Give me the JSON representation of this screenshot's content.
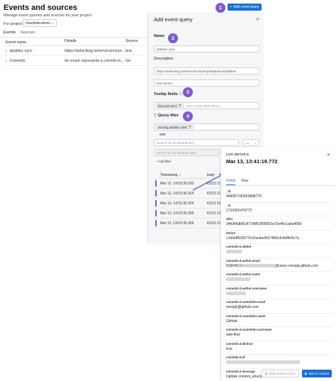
{
  "page": {
    "title": "Events and sources",
    "subtitle": "Manage event queries and sources for your project",
    "project_label": "For project",
    "project_value": "cloudsika-demo",
    "add_event_button": "Add event query",
    "tabs": [
      {
        "label": "Events"
      },
      {
        "label": "Sources"
      }
    ],
    "columns": [
      "Event name",
      "Details",
      "Source"
    ],
    "rows": [
      {
        "name": "iptables sync",
        "details": "https://www.tkng.io/services/clusterip/dataplane/iptables/",
        "source": "test"
      },
      {
        "name": "Commits",
        "details": "An event represents a commit to a repository",
        "source": "Git"
      }
    ]
  },
  "badges": [
    "1",
    "2",
    "3",
    "4"
  ],
  "query_panel": {
    "title": "Add event query",
    "name_label": "Name",
    "name_value": "iptables sync",
    "description_label": "Description",
    "description_value": "https://www.tkng.io/services/clusterip/dataplane/iptables/",
    "source_value": "test source",
    "tooltip_label": "Tooltip fields",
    "tooltip_chip": "k8s.pod.name",
    "tooltip_placeholder": "Enter some field names",
    "filter_label": "Query filter",
    "filter_chip": "syncing iptables rules",
    "and_label": "and",
    "attr_key_placeholder": "Search for an attribute key",
    "operator": "==",
    "attr_value_placeholder": "Search for an attribute value",
    "add_filter": "Add filter",
    "timestamp_header": "Timestamp",
    "body_header": "body",
    "log_rows": [
      {
        "ts": "Mar 13, 14:03:36.933",
        "body": "I0313 21:03"
      },
      {
        "ts": "Mar 13, 14:03:36.924",
        "body": "I0313 21:03"
      },
      {
        "ts": "Mar 13, 14:03:36.924",
        "body": "I0313 21:03"
      },
      {
        "ts": "Mar 13, 14:03:36.055",
        "body": "I0313 21:03"
      },
      {
        "ts": "Mar 13, 14:03:36.055",
        "body": "I0313 21:03"
      }
    ]
  },
  "log_panel": {
    "label": "LOG DETAILS",
    "date": "Mar 13, 13:41:19.772",
    "tabs": [
      "Fields",
      "Raw"
    ],
    "fields": [
      {
        "key": "_id",
        "value": "449087160563898776"
      },
      {
        "key": "_ts",
        "value": "1710362479772"
      },
      {
        "key": "after",
        "value": "34fc84a8661471fdf51f595f10a72e46c1aba4656"
      },
      {
        "key": "before",
        "value": "c1d3eff3d3377b10acfee9417893cfc4ef8e9c7a"
      },
      {
        "key": "commits.0.added",
        "value": ""
      },
      {
        "key": "commits.0.author.email",
        "value": "50364513+",
        "suffix": "@users.noreply.github.com"
      },
      {
        "key": "commits.0.author.name",
        "value": ""
      },
      {
        "key": "commits.0.author.username",
        "value": ""
      },
      {
        "key": "commits.0.committer.email",
        "value": "noreply@github.com"
      },
      {
        "key": "commits.0.committer.name",
        "value": "GitHub"
      },
      {
        "key": "commits.0.committer.username",
        "value": "web-flow"
      },
      {
        "key": "commits.0.distinct",
        "value": "true"
      },
      {
        "key": "commits.0.id",
        "value": ""
      },
      {
        "key": "commits.0.message",
        "value": "Update content_structure.md"
      }
    ],
    "open_traces": "Open linked traces",
    "see_context": "See in context"
  },
  "colors": {
    "accent": "#1a6ed8",
    "badge": "#7c5cd6"
  }
}
